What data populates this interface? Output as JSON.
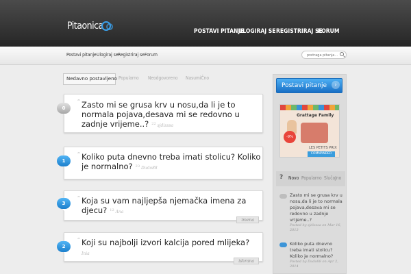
{
  "header": {
    "logo_text": "Pitaonica",
    "nav": [
      "POSTAVI PITANJE",
      "ULOGIRAJ SE",
      "REGISTRIRAJ SE",
      "FORUM"
    ]
  },
  "subnav": [
    "Postavi pitanje",
    "Ulogiraj se",
    "Registriraj se",
    "Forum"
  ],
  "search": {
    "placeholder": "pretraga pitanja..."
  },
  "tabs": [
    "Nedavno postavljeno",
    "Popularno",
    "Neodgovoreno",
    "NasumiČno"
  ],
  "questions": [
    {
      "badge": "0",
      "text": "Zasto mi se grusa krv u nosu,da li je to normala pojava,desava mi se redovno u zadnje vrijeme..?",
      "votes": "22",
      "author": "sjdisssa",
      "tag": ""
    },
    {
      "badge": "1",
      "text": "Koliko puta dnevno treba imati stolicu? Koliko je normalno?",
      "votes": "23",
      "author": "Dudo88",
      "tag": ""
    },
    {
      "badge": "3",
      "text": "Koja su vam najljepša njemačka imena za djecu?",
      "votes": "12",
      "author": "Ana",
      "tag": "imena"
    },
    {
      "badge": "2",
      "text": "Koji su najbolji izvori kalcija pored mlijeka?",
      "votes": "",
      "author": "Inia",
      "tag": "ishrana"
    }
  ],
  "sidebar": {
    "ask_button": "Postavi pitanje",
    "ask_arrow": "›",
    "ad": {
      "brand": "Grattage Family",
      "discount": "-9%",
      "label": "LES PETITS PRIX",
      "button": "COMMANDER"
    },
    "tab_icon": "?",
    "tabs": [
      "Novo",
      "Popularno",
      "SlučaJno"
    ],
    "items": [
      {
        "text": "Zasto mi se grusa krv u nosu,da li je to normala pojava,desava mi se redovno u zadnje vrijeme..?",
        "meta": "Posted by sjdisssa on Mar 16, 2013"
      },
      {
        "text": "Koliko puta dnevno treba imati stolicu? Koliko je normalno?",
        "meta": "Posted by Dudo88 on Apr 2, 2014"
      }
    ]
  },
  "colors": {
    "accent": "#2a8ae0",
    "header_bg": "#333333"
  }
}
